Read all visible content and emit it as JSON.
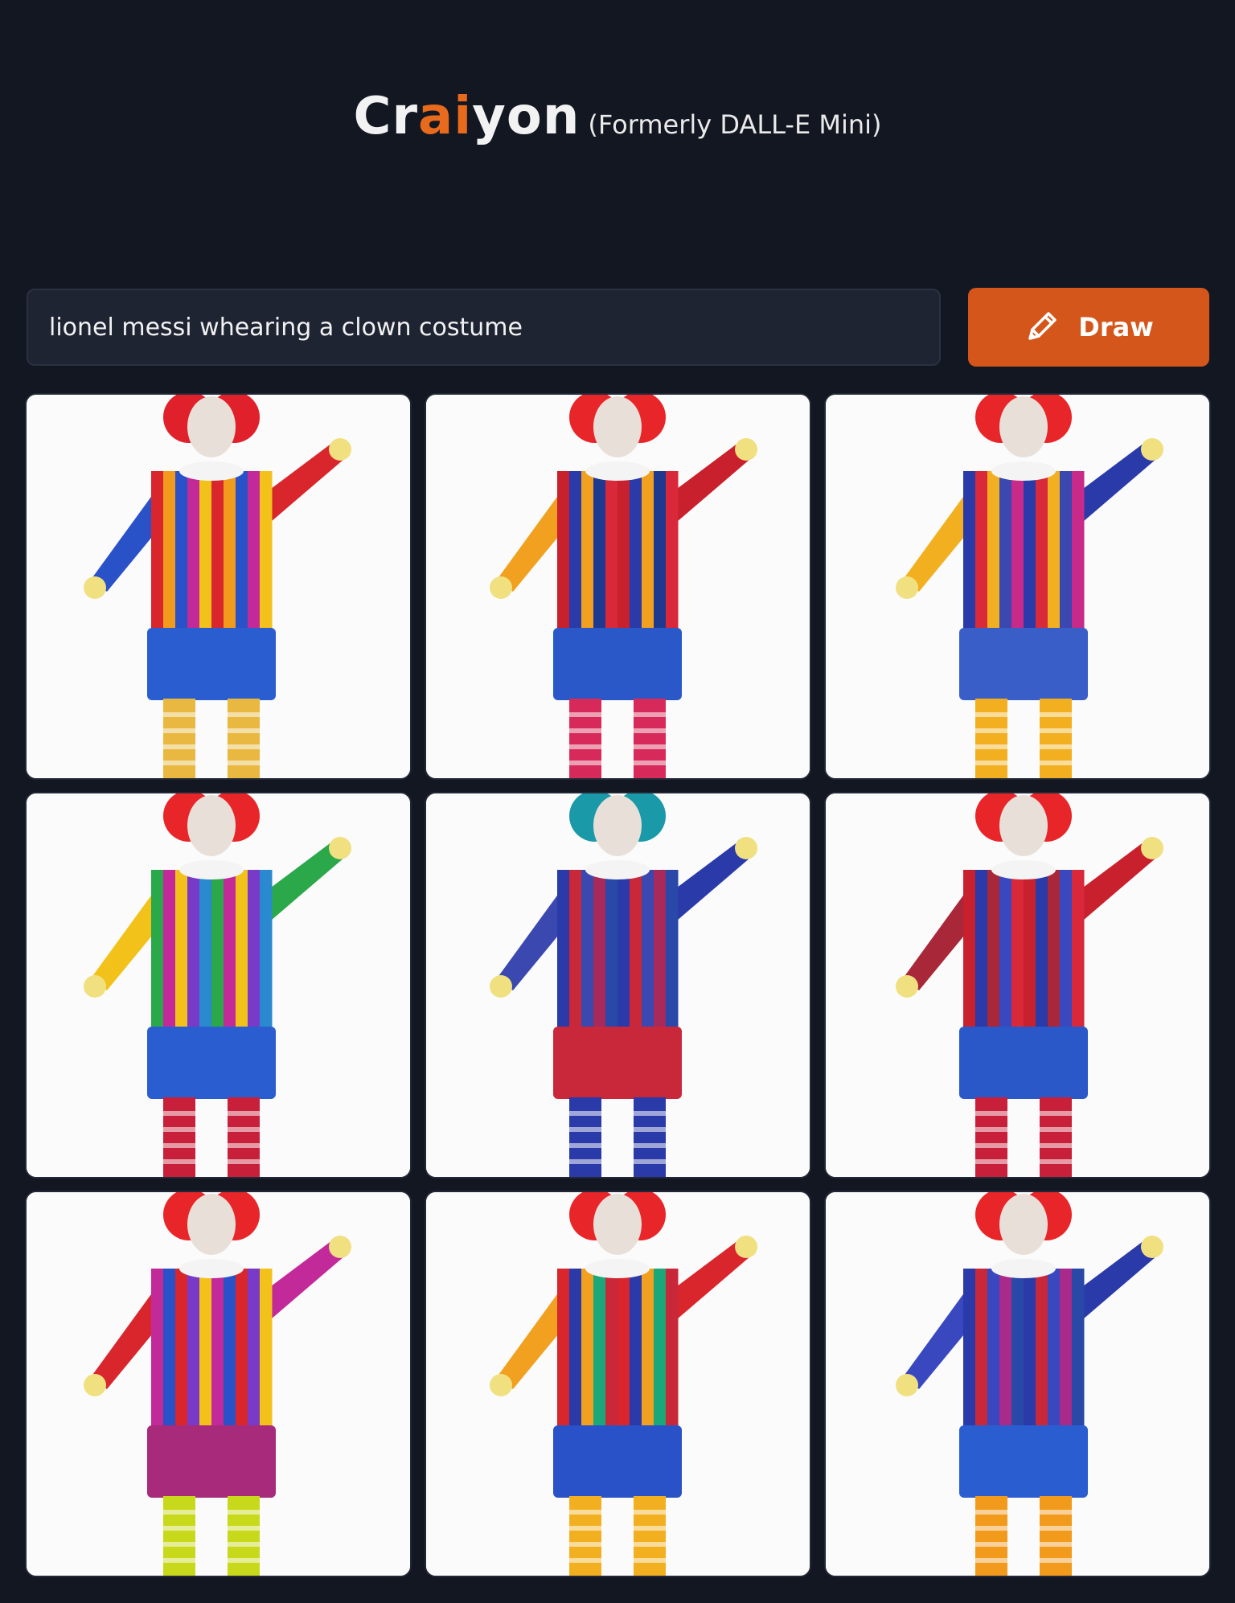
{
  "brand": {
    "name_part1": "Cr",
    "name_accent": "ai",
    "name_part2": "yon",
    "subtitle": "(Formerly DALL-E Mini)",
    "accent_color": "#e86a1c"
  },
  "prompt": {
    "value": "lionel messi whearing a clown costume"
  },
  "draw_button": {
    "label": "Draw",
    "icon": "pencil-icon",
    "color": "#d4561a"
  },
  "results": [
    {
      "hair": "#e0202a",
      "stripes": [
        "#d8262c",
        "#f29a1c",
        "#2a52c8",
        "#c22a9a",
        "#f2c21a"
      ],
      "shorts": "#2a5ed0",
      "legs": "#e8b840"
    },
    {
      "hair": "#e8262a",
      "stripes": [
        "#c8202c",
        "#2a3aa8",
        "#f2a020",
        "#1e3a90",
        "#d8283a"
      ],
      "shorts": "#2a58c8",
      "legs": "#d82a5a"
    },
    {
      "hair": "#e8262a",
      "stripes": [
        "#2a3aa8",
        "#d82a3a",
        "#f2b020",
        "#3a48b0",
        "#c82a8a"
      ],
      "shorts": "#3a5ec8",
      "legs": "#f2b020"
    },
    {
      "hair": "#e8262a",
      "stripes": [
        "#2aa84a",
        "#c22a9a",
        "#f2c21a",
        "#7a3ac8",
        "#2a8ad0"
      ],
      "shorts": "#2a5ed0",
      "legs": "#c8203a"
    },
    {
      "hair": "#1a9aa8",
      "stripes": [
        "#2a3aa8",
        "#c8283a",
        "#3a48b0",
        "#a82a5a",
        "#2a48a8"
      ],
      "shorts": "#c8283a",
      "legs": "#2a3aa8"
    },
    {
      "hair": "#e8262a",
      "stripes": [
        "#c8202c",
        "#2a3aa8",
        "#a8283a",
        "#3a48c0",
        "#d8283a"
      ],
      "shorts": "#2a58c8",
      "legs": "#c8203a"
    },
    {
      "hair": "#e8262a",
      "stripes": [
        "#c22a9a",
        "#2a52c8",
        "#d8262c",
        "#7a3ac8",
        "#f2c21a"
      ],
      "shorts": "#a82a7a",
      "legs": "#c8d81a"
    },
    {
      "hair": "#e8262a",
      "stripes": [
        "#d8262c",
        "#2a3aa8",
        "#f2a020",
        "#1aa87a",
        "#c8283a"
      ],
      "shorts": "#2a52c8",
      "legs": "#f2b020"
    },
    {
      "hair": "#e8262a",
      "stripes": [
        "#2a3aa8",
        "#c8283a",
        "#3a48c0",
        "#a82a8a",
        "#2a48a8"
      ],
      "shorts": "#2a5ed0",
      "legs": "#f29a1c"
    }
  ]
}
